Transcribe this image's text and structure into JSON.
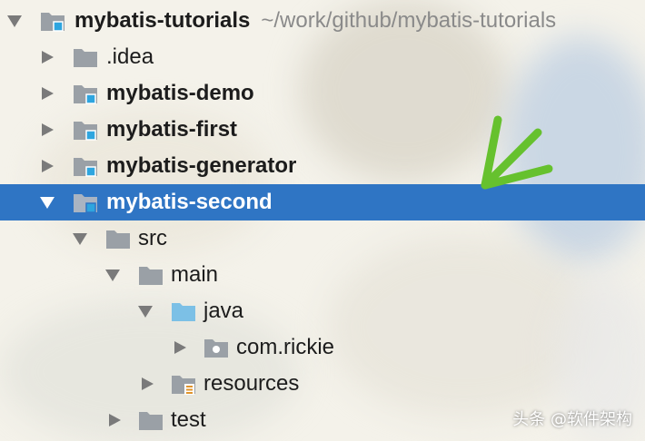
{
  "tree": {
    "root": {
      "label": "mybatis-tutorials",
      "path": "~/work/github/mybatis-tutorials"
    },
    "items": [
      {
        "label": ".idea"
      },
      {
        "label": "mybatis-demo"
      },
      {
        "label": "mybatis-first"
      },
      {
        "label": "mybatis-generator"
      },
      {
        "label": "mybatis-second"
      },
      {
        "label": "src"
      },
      {
        "label": "main"
      },
      {
        "label": "java"
      },
      {
        "label": "com.rickie"
      },
      {
        "label": "resources"
      },
      {
        "label": "test"
      }
    ]
  },
  "watermark": "头条 @软件架构",
  "colors": {
    "selection": "#2f75c4",
    "folder": "#9aa0a6",
    "module_badge": "#2ea5df",
    "source_folder": "#7cc0e6",
    "resources_badge": "#e0942c",
    "annotation_arrow": "#66c12e"
  },
  "icons": {
    "folder": "folder-icon",
    "module": "module-folder-icon",
    "source": "source-folder-icon",
    "package": "package-icon",
    "resources": "resources-folder-icon"
  }
}
